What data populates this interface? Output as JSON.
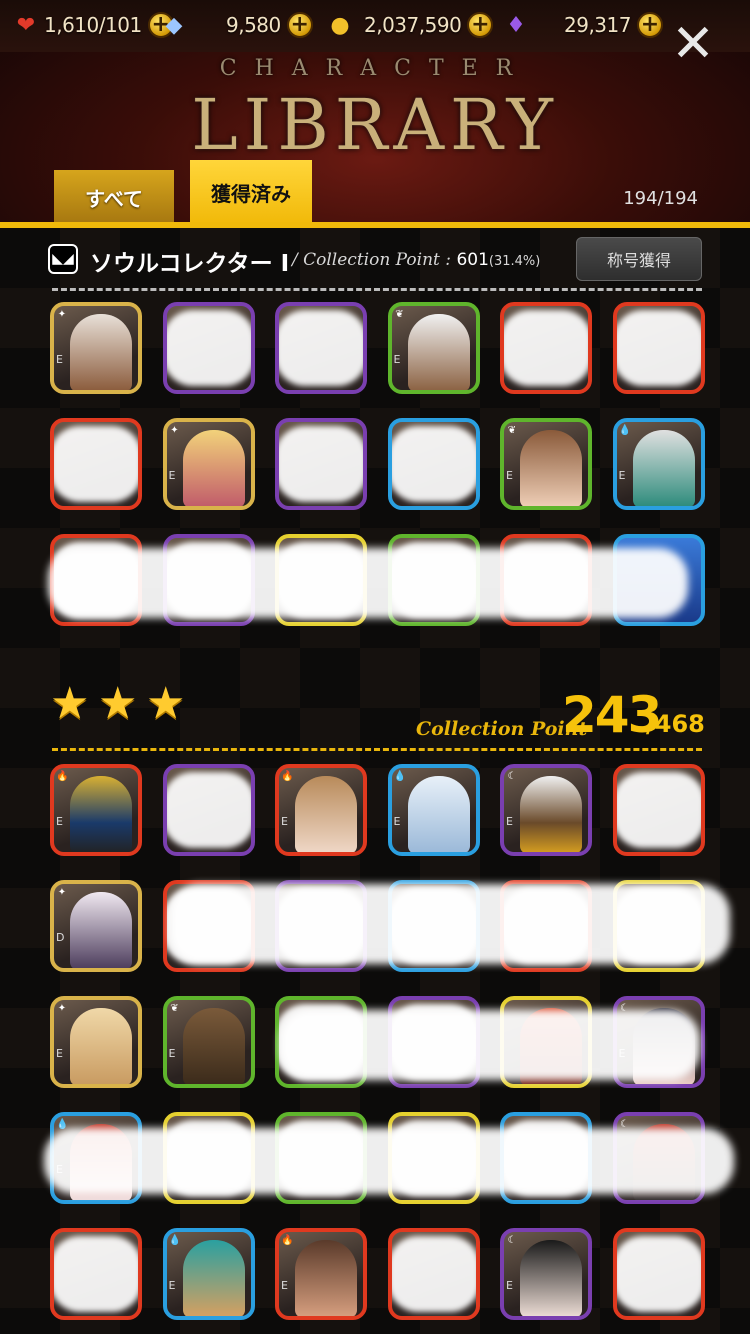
{
  "resources": {
    "stamina": {
      "value": "1,610",
      "max": "/101",
      "icon": "heart-icon"
    },
    "gems": {
      "value": "9,580",
      "icon": "gem-icon"
    },
    "gold": {
      "value": "2,037,590",
      "icon": "coin-icon"
    },
    "crystals": {
      "value": "29,317",
      "icon": "crystal-icon"
    }
  },
  "header": {
    "title_small": "CHARACTER",
    "title_big": "LIBRARY",
    "close_icon": "close-icon"
  },
  "tabs": [
    {
      "label": "すべて",
      "active": false
    },
    {
      "label": "獲得済み",
      "active": true
    }
  ],
  "count": "194/194",
  "collector": {
    "title": "ソウルコレクター Ⅰ",
    "cp_prefix": "/ Collection Point :",
    "cp_value": "601",
    "cp_percent": "(31.4%)",
    "button": "称号獲得"
  },
  "section3": {
    "stars": 3,
    "cp_label": "Collection Point",
    "cp_value": "243",
    "cp_total": "/468"
  },
  "colors": {
    "accent": "#f0b90a",
    "fire": "#e0391f",
    "dark": "#7a3fb0",
    "light": "#d9b34a",
    "wood": "#5fb52c",
    "water": "#2a9fe0"
  }
}
